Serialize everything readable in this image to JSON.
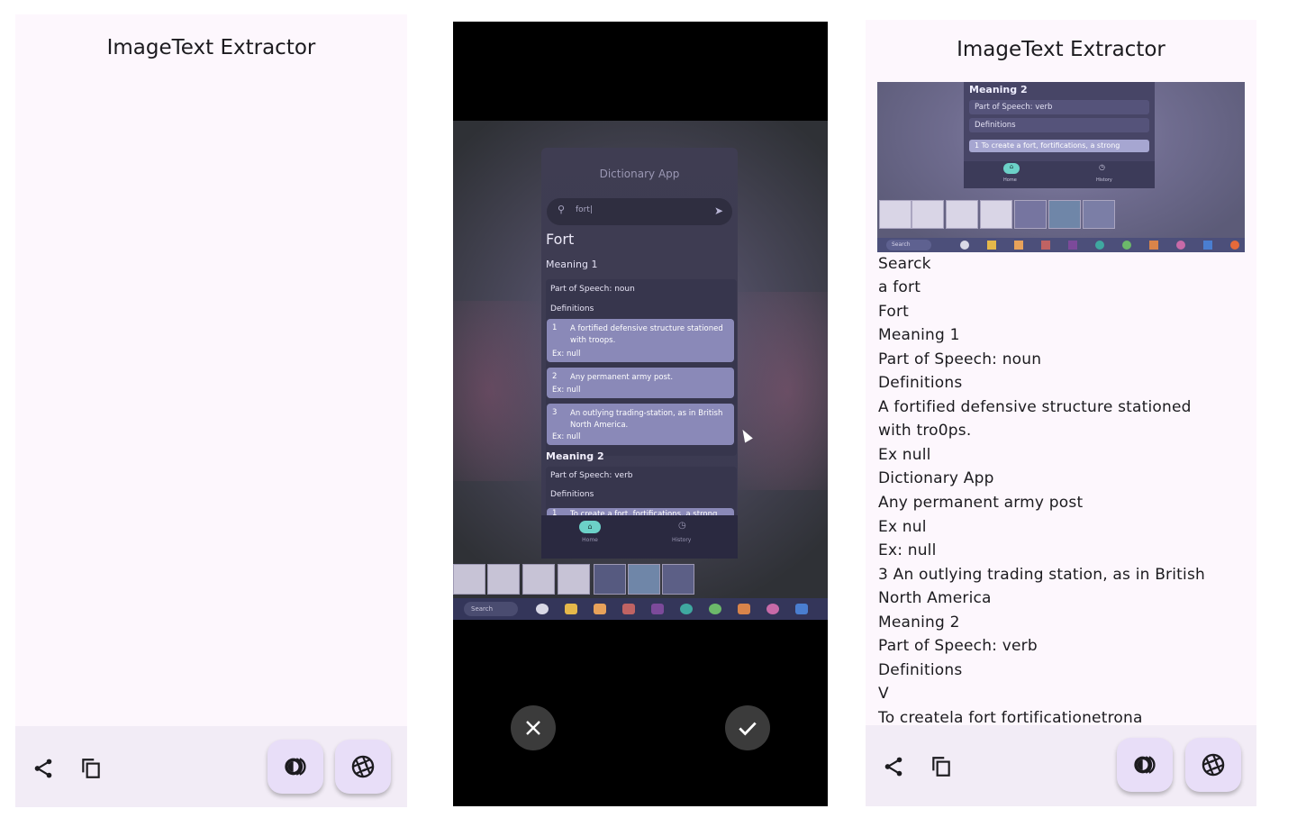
{
  "app_title": "ImageText Extractor",
  "colors": {
    "panel_bg": "#fdf7fd",
    "bottom_bar": "#f2ecf6",
    "fab": "#e8def8",
    "camera_bg": "#000000"
  },
  "icons": {
    "share": "share-icon",
    "copy": "copy-icon",
    "theme": "contrast-icon",
    "camera": "camera-shutter-icon",
    "cancel": "close-icon",
    "confirm": "check-icon"
  },
  "camera": {
    "photo": {
      "app_title": "Dictionary App",
      "search_text": "fort|",
      "word": "Fort",
      "meaning1": "Meaning 1",
      "part_of_speech1": "Part of Speech: noun",
      "definitions_label": "Definitions",
      "defs": [
        {
          "num": "1",
          "text": "A fortified defensive structure stationed with troops.",
          "ex": "Ex: null"
        },
        {
          "num": "2",
          "text": "Any permanent army post.",
          "ex": "Ex: null"
        },
        {
          "num": "3",
          "text": "An outlying trading-station, as in British North America.",
          "ex": "Ex: null"
        }
      ],
      "meaning2": "Meaning 2",
      "part_of_speech2": "Part of Speech: verb",
      "def4": {
        "num": "1",
        "text": "To create a fort, fortifications, a strong"
      },
      "nav_home": "Home",
      "nav_history": "History",
      "taskbar_search": "Search"
    }
  },
  "preview": {
    "meaning2": "Meaning 2",
    "part_of_speech": "Part of Speech: verb",
    "definitions": "Definitions",
    "def": "1   To create a fort, fortifications, a strong",
    "nav_home": "Home",
    "nav_history": "History",
    "taskbar_search": "Search"
  },
  "extracted_lines": [
    "Searck",
    "a fort",
    "Fort",
    "Meaning 1",
    "Part of Speech: noun",
    "Definitions",
    "A fortified defensive structure stationed",
    "with tro0ps.",
    "Ex null",
    "Dictionary App",
    "Any permanent army post",
    "Ex nul",
    "Ex: null",
    "3 An outlying trading station, as in British",
    "North America",
    "Meaning 2",
    "Part of Speech: verb",
    "Definitions",
    "V",
    "To createla fort fortificationetrona"
  ]
}
